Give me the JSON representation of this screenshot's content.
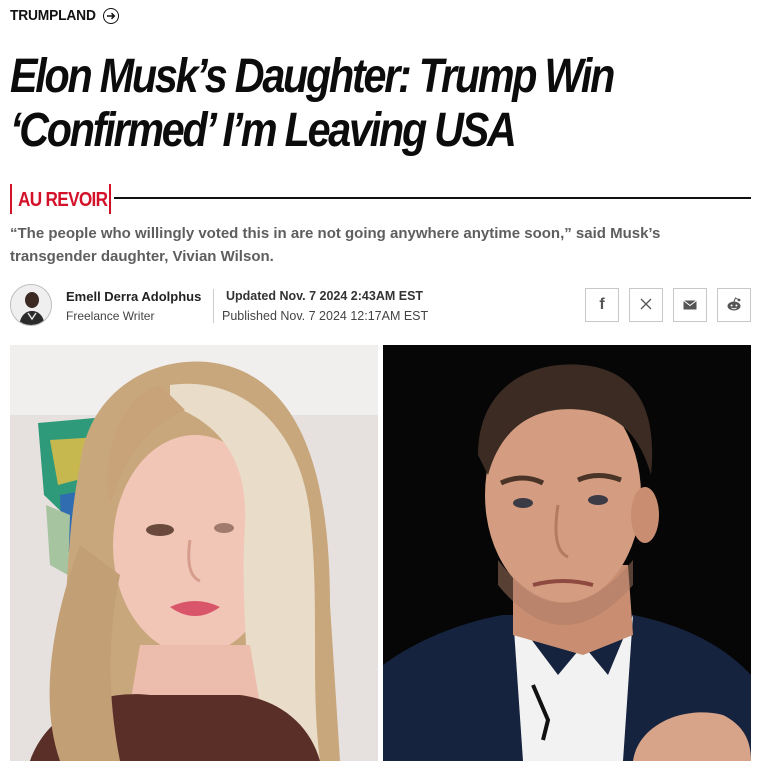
{
  "section": {
    "label": "TRUMPLAND",
    "icon": "arrow-circle-right-icon"
  },
  "headline": "Elon Musk’s Daughter: Trump Win ‘Confirmed’ I’m Leaving USA",
  "kicker": "AU REVOIR",
  "dek": "“The people who willingly voted this in are not going anywhere anytime soon,” said Musk’s transgender daughter, Vivian Wilson.",
  "author": {
    "name": "Emell Derra Adolphus",
    "role": "Freelance Writer"
  },
  "dates": {
    "updated": "Updated Nov. 7 2024 2:43AM EST",
    "published": "Published Nov. 7 2024 12:17AM EST"
  },
  "share": [
    {
      "icon": "facebook-icon",
      "glyph": "f"
    },
    {
      "icon": "x-icon",
      "glyph": "𝕏"
    },
    {
      "icon": "email-icon",
      "glyph": "✉"
    },
    {
      "icon": "reddit-icon",
      "glyph": "◉"
    }
  ],
  "colors": {
    "accent": "#d3122a",
    "dek": "#5e5e5e",
    "text": "#111111"
  }
}
